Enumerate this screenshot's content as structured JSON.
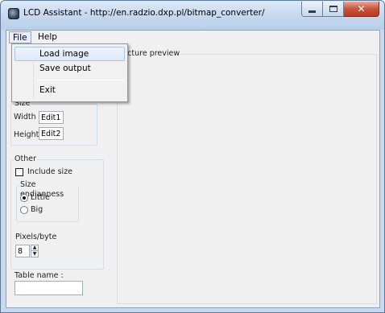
{
  "window": {
    "title": "LCD Assistant - http://en.radzio.dxp.pl/bitmap_converter/"
  },
  "menu": {
    "file": "File",
    "help": "Help",
    "file_items": {
      "load_image": "Load image",
      "save_output": "Save output",
      "exit": "Exit"
    }
  },
  "preview": {
    "label": "Picture preview"
  },
  "size": {
    "label": "Size",
    "width_label": "Width",
    "width_value": "Edit1",
    "height_label": "Height",
    "height_value": "Edit2"
  },
  "other": {
    "label": "Other",
    "include_size_label": "Include size",
    "include_size_checked": false,
    "endianness": {
      "label": "Size endianness",
      "options": [
        "Little",
        "Big"
      ],
      "selected": "Little"
    },
    "pixels_per_byte_label": "Pixels/byte",
    "pixels_per_byte_value": "8"
  },
  "table_name": {
    "label": "Table name :",
    "value": ""
  }
}
